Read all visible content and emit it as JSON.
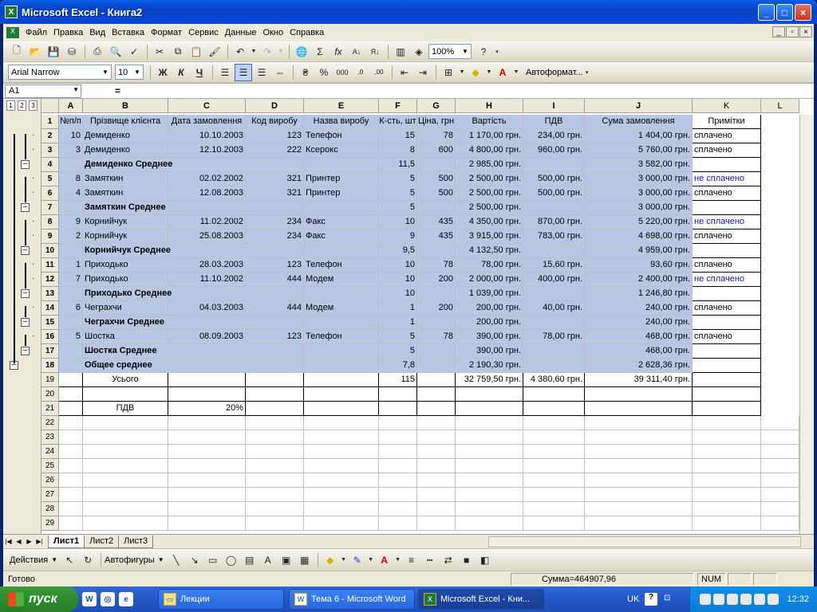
{
  "window": {
    "title": "Microsoft Excel - Книга2",
    "icon": "excel-icon"
  },
  "menu": [
    "Файл",
    "Правка",
    "Вид",
    "Вставка",
    "Формат",
    "Сервис",
    "Данные",
    "Окно",
    "Справка"
  ],
  "toolbar": {
    "zoom": "100%"
  },
  "format_toolbar": {
    "font": "Arial Narrow",
    "size": "10",
    "bold": "Ж",
    "italic": "К",
    "underline": "Ч",
    "autoformat": "Автоформат..."
  },
  "formula_bar": {
    "name_box": "A1",
    "fx": "="
  },
  "outline_levels": [
    "1",
    "2",
    "3"
  ],
  "columns": [
    "A",
    "B",
    "C",
    "D",
    "E",
    "F",
    "G",
    "H",
    "I",
    "J",
    "K",
    "L"
  ],
  "rows": [
    {
      "n": "1",
      "cells": [
        "№п/п",
        "Прізвище клієнта",
        "Дата замовлення",
        "Код виробу",
        "Назва виробу",
        "К-сть, шт",
        "Ціна, грн",
        "Вартість",
        "ПДВ",
        "Сума замовлення",
        "Примітки"
      ]
    },
    {
      "n": "2",
      "cells": [
        "10",
        "Демиденко",
        "10.10.2003",
        "123",
        "Телефон",
        "15",
        "78",
        "1 170,00 грн.",
        "234,00 грн.",
        "1 404,00 грн.",
        "сплачено"
      ]
    },
    {
      "n": "3",
      "cells": [
        "3",
        "Демиденко",
        "12.10.2003",
        "222",
        "Ксерокс",
        "8",
        "600",
        "4 800,00 грн.",
        "960,00 грн.",
        "5 760,00 грн.",
        "сплачено"
      ]
    },
    {
      "n": "4",
      "cells": [
        "",
        "Демиденко Среднее",
        "",
        "",
        "",
        "11,5",
        "",
        "2 985,00 грн.",
        "",
        "3 582,00 грн.",
        ""
      ]
    },
    {
      "n": "5",
      "cells": [
        "8",
        "Замяткин",
        "02.02.2002",
        "321",
        "Принтер",
        "5",
        "500",
        "2 500,00 грн.",
        "500,00 грн.",
        "3 000,00 грн.",
        "не сплачено"
      ]
    },
    {
      "n": "6",
      "cells": [
        "4",
        "Замяткин",
        "12.08.2003",
        "321",
        "Принтер",
        "5",
        "500",
        "2 500,00 грн.",
        "500,00 грн.",
        "3 000,00 грн.",
        "сплачено"
      ]
    },
    {
      "n": "7",
      "cells": [
        "",
        "Замяткин Среднее",
        "",
        "",
        "",
        "5",
        "",
        "2 500,00 грн.",
        "",
        "3 000,00 грн.",
        ""
      ]
    },
    {
      "n": "8",
      "cells": [
        "9",
        "Корнийчук",
        "11.02.2002",
        "234",
        "Факс",
        "10",
        "435",
        "4 350,00 грн.",
        "870,00 грн.",
        "5 220,00 грн.",
        "не сплачено"
      ]
    },
    {
      "n": "9",
      "cells": [
        "2",
        "Корнийчук",
        "25.08.2003",
        "234",
        "Факс",
        "9",
        "435",
        "3 915,00 грн.",
        "783,00 грн.",
        "4 698,00 грн.",
        "сплачено"
      ]
    },
    {
      "n": "10",
      "cells": [
        "",
        "Корнийчук Среднее",
        "",
        "",
        "",
        "9,5",
        "",
        "4 132,50 грн.",
        "",
        "4 959,00 грн.",
        ""
      ]
    },
    {
      "n": "11",
      "cells": [
        "1",
        "Приходько",
        "28.03.2003",
        "123",
        "Телефон",
        "10",
        "78",
        "78,00 грн.",
        "15,60 грн.",
        "93,60 грн.",
        "сплачено"
      ]
    },
    {
      "n": "12",
      "cells": [
        "7",
        "Приходько",
        "11.10.2002",
        "444",
        "Модем",
        "10",
        "200",
        "2 000,00 грн.",
        "400,00 грн.",
        "2 400,00 грн.",
        "не сплачено"
      ]
    },
    {
      "n": "13",
      "cells": [
        "",
        "Приходько Среднее",
        "",
        "",
        "",
        "10",
        "",
        "1 039,00 грн.",
        "",
        "1 246,80 грн.",
        ""
      ]
    },
    {
      "n": "14",
      "cells": [
        "6",
        "Чеграхчи",
        "04.03.2003",
        "444",
        "Модем",
        "1",
        "200",
        "200,00 грн.",
        "40,00 грн.",
        "240,00 грн.",
        "сплачено"
      ]
    },
    {
      "n": "15",
      "cells": [
        "",
        "Чеграхчи Среднее",
        "",
        "",
        "",
        "1",
        "",
        "200,00 грн.",
        "",
        "240,00 грн.",
        ""
      ]
    },
    {
      "n": "16",
      "cells": [
        "5",
        "Шостка",
        "08.09.2003",
        "123",
        "Телефон",
        "5",
        "78",
        "390,00 грн.",
        "78,00 грн.",
        "468,00 грн.",
        "сплачено"
      ]
    },
    {
      "n": "17",
      "cells": [
        "",
        "Шостка Среднее",
        "",
        "",
        "",
        "5",
        "",
        "390,00 грн.",
        "",
        "468,00 грн.",
        ""
      ]
    },
    {
      "n": "18",
      "cells": [
        "",
        "Общее среднее",
        "",
        "",
        "",
        "7,8",
        "",
        "2 190,30 грн.",
        "",
        "2 628,36 грн.",
        ""
      ]
    },
    {
      "n": "19",
      "cells": [
        "",
        "Усього",
        "",
        "",
        "",
        "115",
        "",
        "32 759,50 грн.",
        "4 380,60 грн.",
        "39 311,40 грн.",
        ""
      ]
    },
    {
      "n": "20",
      "cells": [
        "",
        "",
        "",
        "",
        "",
        "",
        "",
        "",
        "",
        "",
        ""
      ]
    },
    {
      "n": "21",
      "cells": [
        "",
        "ПДВ",
        "20%",
        "",
        "",
        "",
        "",
        "",
        "",
        "",
        ""
      ]
    }
  ],
  "empty_rows": [
    "22",
    "23",
    "24",
    "25",
    "26",
    "27",
    "28",
    "29"
  ],
  "sheet_tabs": [
    "Лист1",
    "Лист2",
    "Лист3"
  ],
  "drawing": {
    "actions": "Действия",
    "autoshapes": "Автофигуры"
  },
  "status": {
    "ready": "Готово",
    "sum": "Сумма=464907,96",
    "num": "NUM"
  },
  "taskbar": {
    "start": "пуск",
    "items": [
      "Лекции",
      "Тема 6 - Microsoft Word",
      "Microsoft Excel - Кни..."
    ],
    "lang": "UK",
    "clock": "12:32"
  }
}
